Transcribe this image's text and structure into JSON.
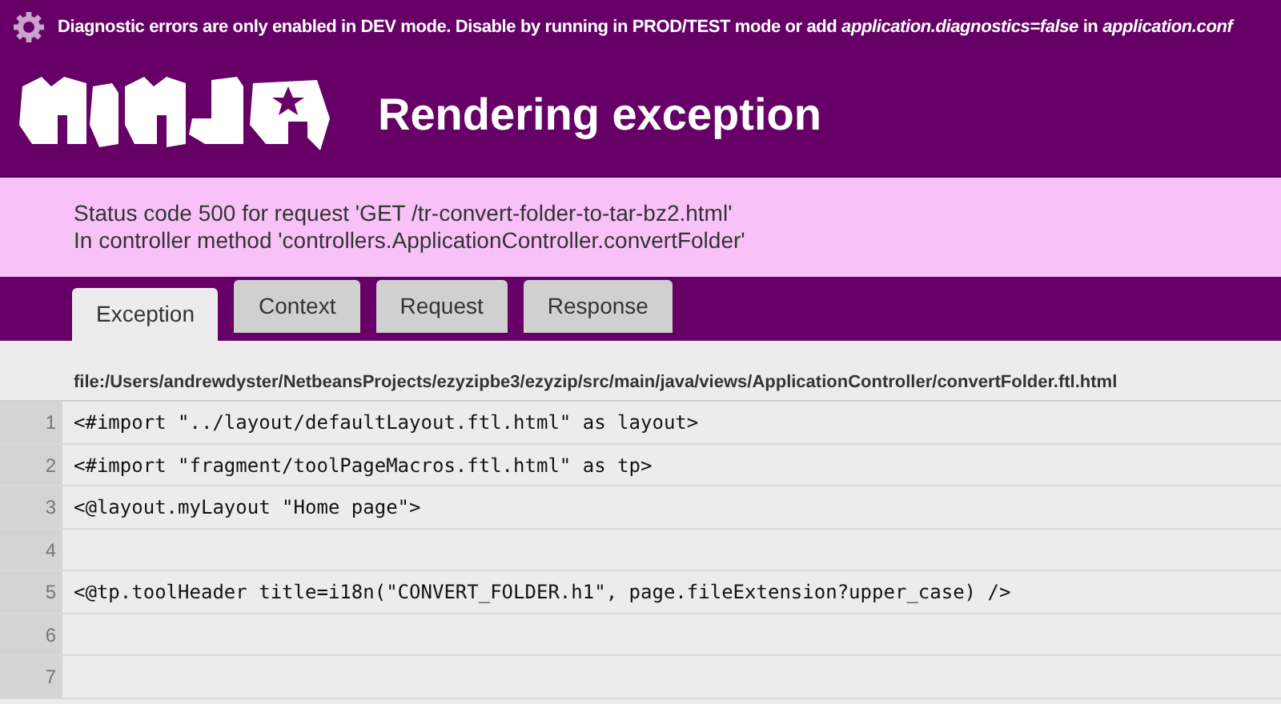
{
  "notice": {
    "text": "Diagnostic errors are only enabled in DEV mode. Disable by running in PROD/TEST mode or add *application.diagnostics=false* in *application.conf*"
  },
  "header": {
    "title": "Rendering exception"
  },
  "status": {
    "lines": [
      "Status code 500 for request 'GET /tr-convert-folder-to-tar-bz2.html'",
      "In controller method 'controllers.ApplicationController.convertFolder'"
    ]
  },
  "tabs": [
    {
      "label": "Exception",
      "selected": true
    },
    {
      "label": "Context",
      "selected": false
    },
    {
      "label": "Request",
      "selected": false
    },
    {
      "label": "Response",
      "selected": false
    }
  ],
  "file_path": "file:/Users/andrewdyster/NetbeansProjects/ezyzipbe3/ezyzip/src/main/java/views/ApplicationController/convertFolder.ftl.html",
  "code_lines": [
    {
      "number": "1",
      "code": "<#import \"../layout/defaultLayout.ftl.html\" as layout>"
    },
    {
      "number": "2",
      "code": "<#import \"fragment/toolPageMacros.ftl.html\" as tp>"
    },
    {
      "number": "3",
      "code": "<@layout.myLayout \"Home page\">"
    },
    {
      "number": "4"
    },
    {
      "number": "5",
      "code": "<@tp.toolHeader title=i18n(\"CONVERT_FOLDER.h1\", page.fileExtension?upper_case) />"
    },
    {
      "number": "6"
    },
    {
      "number": "7"
    }
  ]
}
